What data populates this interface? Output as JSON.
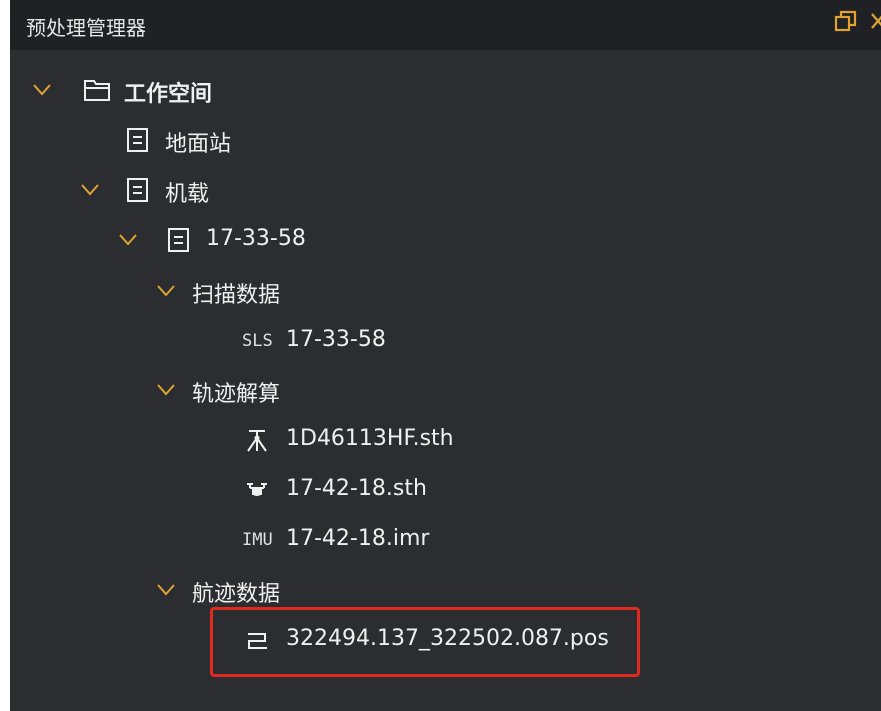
{
  "panel": {
    "title": "预处理管理器",
    "restore_icon": "restore-window-icon",
    "close_icon": "close-icon"
  },
  "colors": {
    "panel_bg": "#2b2d30",
    "titlebar_bg": "#1f2124",
    "chevron": "#e0a42e",
    "text": "#f0f0f0",
    "highlight_border": "#e02a20"
  },
  "tree": {
    "workspace": {
      "label": "工作空间",
      "icon": "folder-icon",
      "expanded": true
    },
    "ground_station": {
      "label": "地面站",
      "icon": "document-icon"
    },
    "airborne": {
      "label": "机载",
      "icon": "document-icon",
      "expanded": true
    },
    "session": {
      "label": "17-33-58",
      "icon": "document-icon",
      "expanded": true
    },
    "scan_data": {
      "label": "扫描数据",
      "expanded": true
    },
    "sls_file": {
      "prefix": "SLS",
      "label": "17-33-58"
    },
    "trajectory_solve": {
      "label": "轨迹解算",
      "expanded": true
    },
    "base_file": {
      "label": "1D46113HF.sth",
      "icon": "base-station-icon"
    },
    "drone_file": {
      "label": "17-42-18.sth",
      "icon": "drone-icon"
    },
    "imu_file": {
      "prefix": "IMU",
      "label": "17-42-18.imr"
    },
    "trajectory_data": {
      "label": "航迹数据",
      "expanded": true
    },
    "pos_file": {
      "label": "322494.137_322502.087.pos",
      "icon": "trajectory-icon",
      "highlighted": true
    }
  }
}
